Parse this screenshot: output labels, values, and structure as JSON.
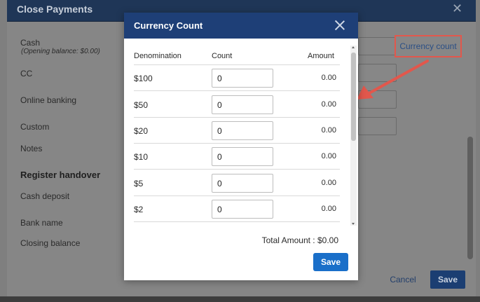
{
  "background": {
    "title": "Close Payments",
    "labels": {
      "cash": "Cash",
      "opening_balance": "(Opening balance: $0.00)",
      "cc": "CC",
      "online_banking": "Online banking",
      "custom": "Custom",
      "notes": "Notes",
      "register_handover": "Register handover",
      "cash_deposit": "Cash deposit",
      "bank_name": "Bank name",
      "closing_balance": "Closing balance"
    },
    "currency_count_link": "Currency count",
    "cancel_label": "Cancel",
    "save_label": "Save"
  },
  "modal": {
    "title": "Currency Count",
    "headers": {
      "denomination": "Denomination",
      "count": "Count",
      "amount": "Amount"
    },
    "rows": [
      {
        "denomination": "$100",
        "count": "0",
        "amount": "0.00"
      },
      {
        "denomination": "$50",
        "count": "0",
        "amount": "0.00"
      },
      {
        "denomination": "$20",
        "count": "0",
        "amount": "0.00"
      },
      {
        "denomination": "$10",
        "count": "0",
        "amount": "0.00"
      },
      {
        "denomination": "$5",
        "count": "0",
        "amount": "0.00"
      },
      {
        "denomination": "$2",
        "count": "0",
        "amount": "0.00"
      }
    ],
    "total": "Total Amount : $0.00",
    "save_label": "Save"
  },
  "colors": {
    "header_bg": "#1e3f77",
    "save_button": "#1a6fc9",
    "highlight": "#e2574c"
  },
  "icons": {
    "modal_close": "close-icon",
    "background_close": "close-icon",
    "annotation": "arrow-icon"
  }
}
